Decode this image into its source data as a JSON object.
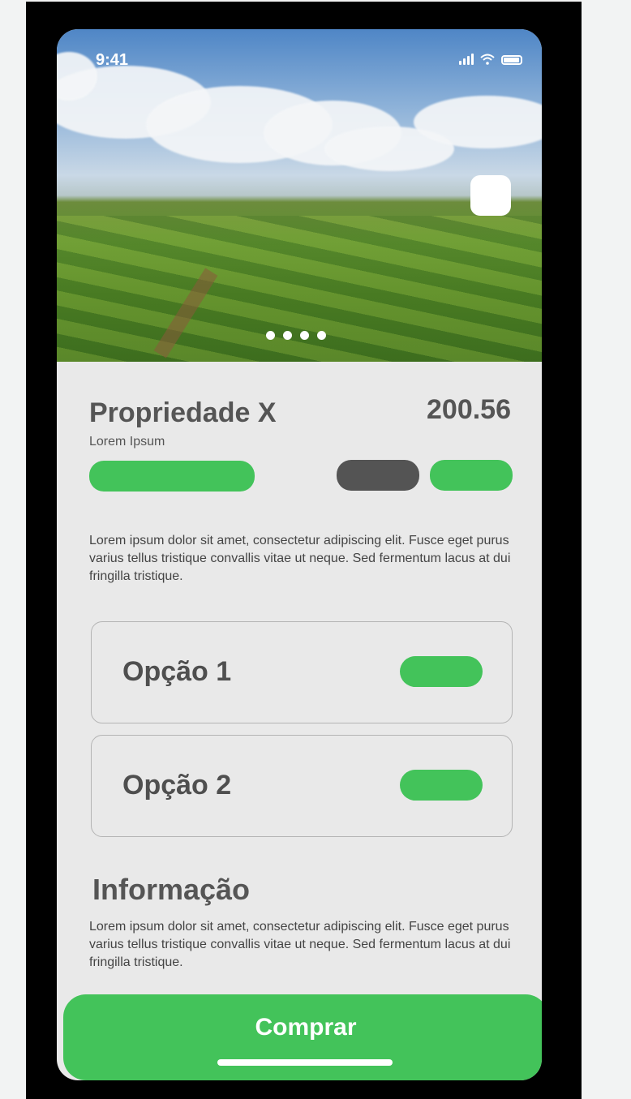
{
  "status_bar": {
    "time": "9:41",
    "icons": [
      "signal-icon",
      "wifi-icon",
      "battery-icon"
    ]
  },
  "hero": {
    "carousel_page_count": 4,
    "favorite_icon": "bookmark-icon"
  },
  "property": {
    "title": "Propriedade X",
    "subtitle": "Lorem Ipsum",
    "price": "200.56",
    "description": "Lorem ipsum dolor sit amet, consectetur adipiscing elit. Fusce eget purus varius tellus tristique convallis vitae ut neque. Sed fermentum lacus at dui fringilla tristique."
  },
  "options": [
    {
      "label": "Opção 1"
    },
    {
      "label": "Opção 2"
    }
  ],
  "info": {
    "title": "Informação",
    "text": "Lorem ipsum dolor sit amet, consectetur adipiscing elit. Fusce eget purus varius tellus tristique convallis vitae ut neque. Sed fermentum lacus at dui fringilla tristique."
  },
  "cta": {
    "label": "Comprar"
  },
  "colors": {
    "accent": "#43c35a",
    "dark_pill": "#545454",
    "text": "#555555",
    "background": "#e9e9e9"
  }
}
